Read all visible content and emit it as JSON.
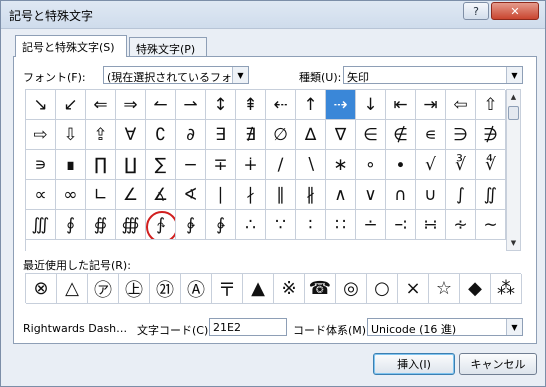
{
  "window": {
    "title": "記号と特殊文字",
    "help_icon": "?",
    "close_icon": "✕"
  },
  "tabs": [
    "記号と特殊文字(S)",
    "特殊文字(P)"
  ],
  "font": {
    "label": "フォント(F):",
    "value": "(現在選択されているフォント)"
  },
  "subset": {
    "label": "種類(U):",
    "value": "矢印"
  },
  "symbols": [
    [
      "↘",
      "↙",
      "⇐",
      "⇒",
      "↼",
      "⇀",
      "↕",
      "⇞",
      "⇠",
      "↑",
      "⇢",
      "↓",
      "⇤",
      "⇥",
      "⇦",
      "⇧"
    ],
    [
      "⇨",
      "⇩",
      "⇪",
      "∀",
      "∁",
      "∂",
      "∃",
      "∄",
      "∅",
      "∆",
      "∇",
      "∈",
      "∉",
      "∊",
      "∋",
      "∌"
    ],
    [
      "∍",
      "∎",
      "∏",
      "∐",
      "∑",
      "−",
      "∓",
      "∔",
      "∕",
      "∖",
      "∗",
      "∘",
      "∙",
      "√",
      "∛",
      "∜"
    ],
    [
      "∝",
      "∞",
      "∟",
      "∠",
      "∡",
      "∢",
      "∣",
      "∤",
      "∥",
      "∦",
      "∧",
      "∨",
      "∩",
      "∪",
      "∫",
      "∬"
    ],
    [
      "∭",
      "∮",
      "∯",
      "∰",
      "∱",
      "∲",
      "∳",
      "∴",
      "∵",
      "∶",
      "∷",
      "∸",
      "∹",
      "∺",
      "∻",
      "∼"
    ]
  ],
  "selected_symbol": "⇢",
  "circled_symbol": "∱",
  "recent": {
    "label": "最近使用した記号(R):",
    "items": [
      "⊗",
      "△",
      "㋐",
      "㊤",
      "㉑",
      "Ⓐ",
      "〒",
      "▲",
      "※",
      "☎",
      "◎",
      "○",
      "×",
      "☆",
      "◆",
      "⁂"
    ]
  },
  "char_name": "Rightwards Dash…",
  "code": {
    "label": "文字コード(C):",
    "value": "21E2"
  },
  "encoding": {
    "label": "コード体系(M):",
    "value": "Unicode (16 進)"
  },
  "buttons": {
    "insert": "挿入(I)",
    "cancel": "キャンセル"
  }
}
